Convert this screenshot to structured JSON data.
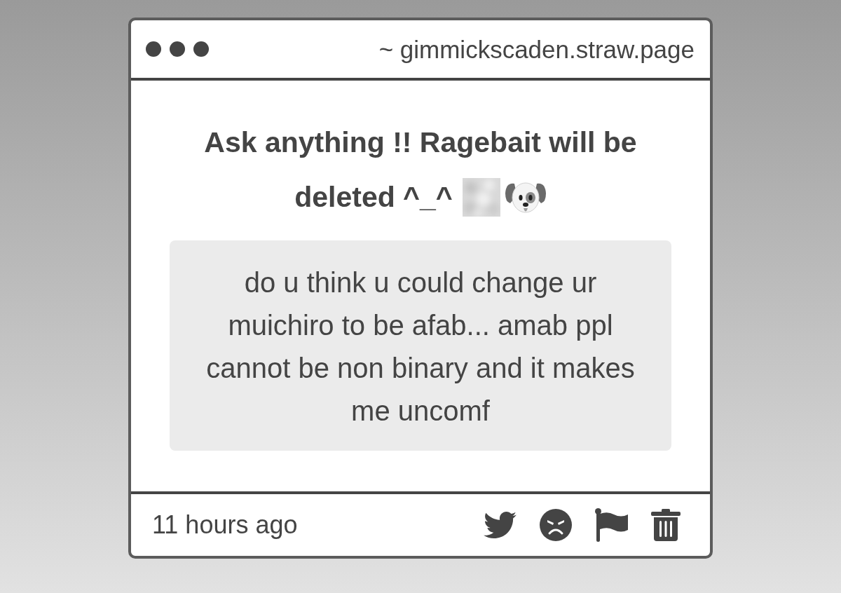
{
  "window": {
    "address": "~ gimmickscaden.straw.page"
  },
  "page": {
    "title_lines": [
      "Ask anything !! Ragebait will be",
      "deleted ^_^"
    ]
  },
  "question": {
    "text": "do u think u could change ur muichiro to be afab... amab ppl cannot be non binary and it makes me uncomf"
  },
  "footer": {
    "time": "11 hours ago"
  }
}
